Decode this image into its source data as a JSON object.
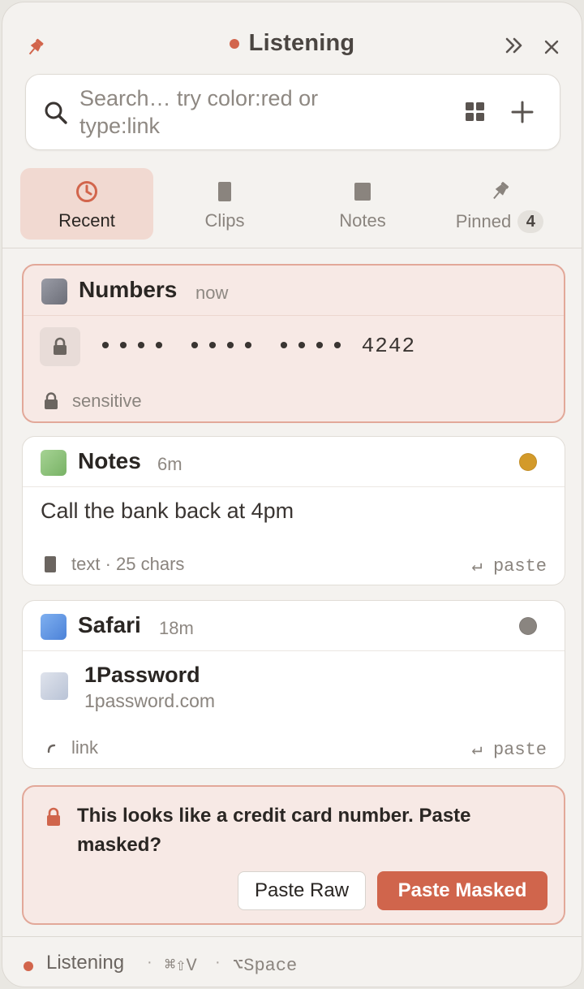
{
  "header": {
    "title": "Listening",
    "status_color": "#d2654c",
    "pin_icon": "pin-icon",
    "collapse_icon": "double-chevron-right-icon",
    "close_icon": "close-icon"
  },
  "search": {
    "placeholder": "Search… try color:red or type:link",
    "value": "",
    "grid_icon": "grid-icon",
    "add_icon": "plus-icon"
  },
  "tabs": [
    {
      "label": "Recent",
      "icon": "clock-icon",
      "active": true
    },
    {
      "label": "Clips",
      "icon": "clip-icon",
      "active": false
    },
    {
      "label": "Notes",
      "icon": "note-icon",
      "active": false
    },
    {
      "label": "Pinned",
      "icon": "pin-icon",
      "active": false,
      "count": "4"
    }
  ],
  "clips": [
    {
      "app": "Numbers",
      "time": "now",
      "app_color": "#7d7f88",
      "content_masked": "•••• •••• ••••",
      "content_last4": "4242",
      "meta": "sensitive",
      "sensitive": true
    },
    {
      "app": "Notes",
      "time": "6m",
      "app_color": "#8cc07a",
      "tag_color": "#d39a2a",
      "content": "Call the bank back at 4pm",
      "meta": "text · 25 chars",
      "action": "↵ paste"
    },
    {
      "app": "Safari",
      "time": "18m",
      "app_color": "#5f94e0",
      "tag_color": "#8a8580",
      "link_title": "1Password",
      "link_url": "1password.com",
      "meta": "link",
      "action": "↵ paste"
    }
  ],
  "warning": {
    "message": "This looks like a credit card number. Paste masked?",
    "raw_label": "Paste Raw",
    "masked_label": "Paste Masked",
    "accent": "#d0654c"
  },
  "statusbar": {
    "status": "Listening",
    "sep": "·",
    "shortcut_1": "⌘⇧V",
    "shortcut_2": "⌥Space"
  }
}
